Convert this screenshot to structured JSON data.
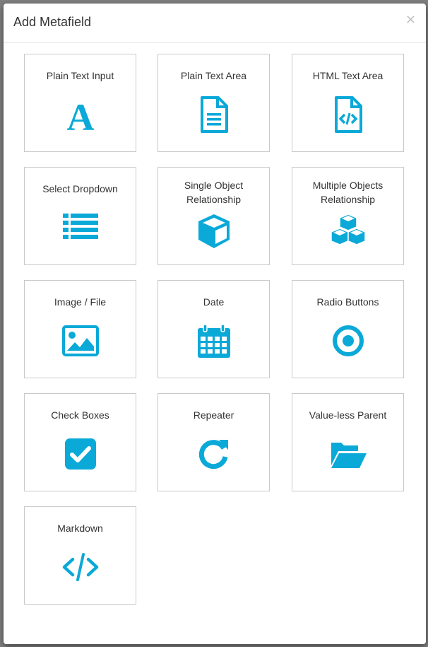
{
  "modal": {
    "title": "Add Metafield",
    "close_label": "×"
  },
  "accent_color": "#0aa9d8",
  "fields": [
    {
      "label": "Plain Text Input",
      "icon": "font-icon"
    },
    {
      "label": "Plain Text Area",
      "icon": "file-text-icon"
    },
    {
      "label": "HTML Text Area",
      "icon": "file-code-icon"
    },
    {
      "label": "Select Dropdown",
      "icon": "list-icon"
    },
    {
      "label": "Single Object Relationship",
      "icon": "cube-icon"
    },
    {
      "label": "Multiple Objects Relationship",
      "icon": "cubes-icon"
    },
    {
      "label": "Image / File",
      "icon": "image-icon"
    },
    {
      "label": "Date",
      "icon": "calendar-icon"
    },
    {
      "label": "Radio Buttons",
      "icon": "dot-circle-icon"
    },
    {
      "label": "Check Boxes",
      "icon": "check-square-icon"
    },
    {
      "label": "Repeater",
      "icon": "repeat-icon"
    },
    {
      "label": "Value-less Parent",
      "icon": "folder-open-icon"
    },
    {
      "label": "Markdown",
      "icon": "code-icon"
    }
  ]
}
